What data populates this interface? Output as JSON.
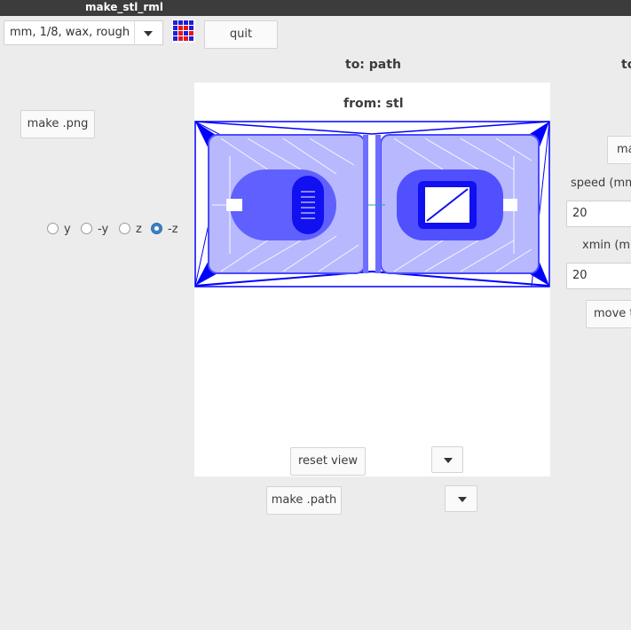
{
  "window": {
    "title": "make_stl_rml"
  },
  "toolbar": {
    "process_select": "mm, 1/8, wax, rough",
    "quit_label": "quit"
  },
  "left": {
    "make_png_label": "make .png",
    "orientation_options": [
      "y",
      "-y",
      "z",
      "-z"
    ],
    "orientation_selected": "-z"
  },
  "center": {
    "to_path_label": "to: path",
    "from_stl_label": "from: stl",
    "reset_view_label": "reset view",
    "make_path_label": "make .path"
  },
  "right": {
    "to_label": "to",
    "make_button_partial": "ma",
    "speed_label": "speed (mm",
    "speed_value": "20",
    "xmin_label": "xmin (mn",
    "xmin_value": "20",
    "move_button_partial": "move t"
  },
  "colors": {
    "mesh": "#0000ff",
    "accent": "#3c80c6"
  }
}
